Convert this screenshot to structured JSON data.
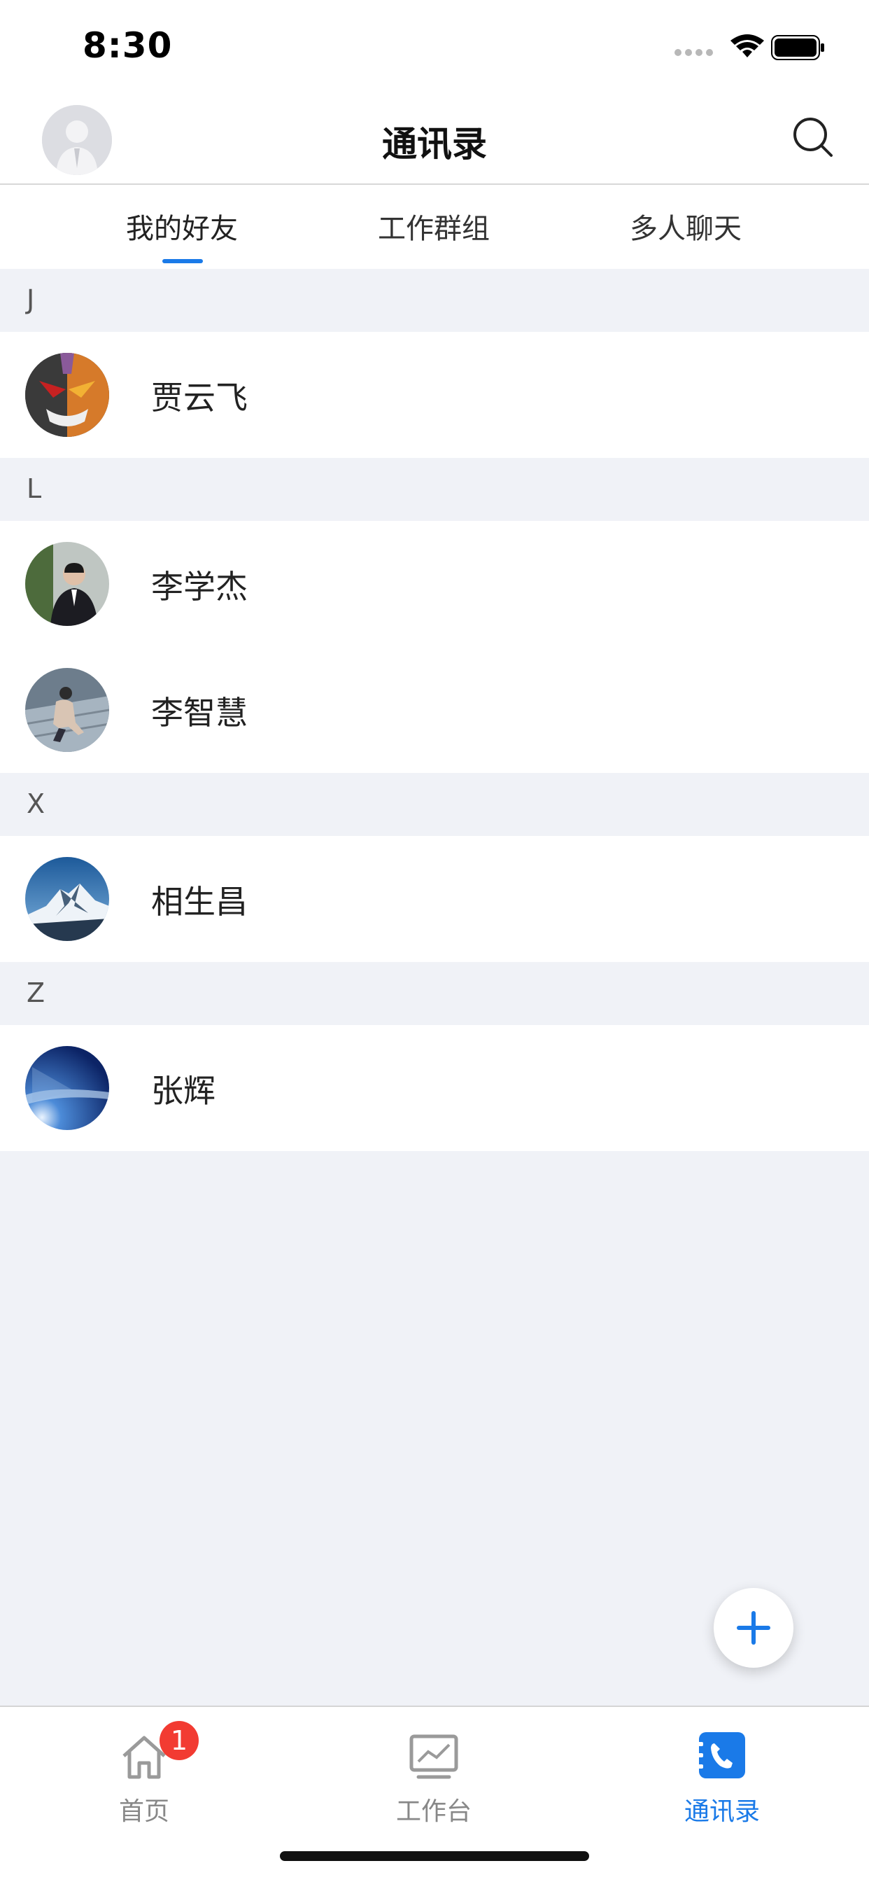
{
  "status_bar": {
    "time": "8:30"
  },
  "header": {
    "title": "通讯录",
    "search_icon": "search-icon",
    "avatar_icon": "user-avatar-placeholder"
  },
  "tabs": [
    {
      "label": "我的好友",
      "active": true
    },
    {
      "label": "工作群组",
      "active": false
    },
    {
      "label": "多人聊天",
      "active": false
    }
  ],
  "contacts": {
    "sections": [
      {
        "letter": "J",
        "items": [
          {
            "name": "贾云飞",
            "avatar": "anime-mask"
          }
        ]
      },
      {
        "letter": "L",
        "items": [
          {
            "name": "李学杰",
            "avatar": "man-in-suit"
          },
          {
            "name": "李智慧",
            "avatar": "person-sitting"
          }
        ]
      },
      {
        "letter": "X",
        "items": [
          {
            "name": "相生昌",
            "avatar": "snowy-mountain"
          }
        ]
      },
      {
        "letter": "Z",
        "items": [
          {
            "name": "张辉",
            "avatar": "blue-sky"
          }
        ]
      }
    ]
  },
  "fab": {
    "icon": "plus-icon"
  },
  "tabbar": {
    "items": [
      {
        "label": "首页",
        "icon": "home-icon",
        "badge": "1",
        "active": false
      },
      {
        "label": "工作台",
        "icon": "chart-board-icon",
        "active": false
      },
      {
        "label": "通讯录",
        "icon": "phone-book-icon",
        "active": true
      }
    ]
  },
  "colors": {
    "accent": "#1a7ae8",
    "badge": "#f23b32",
    "background": "#f0f2f7"
  }
}
